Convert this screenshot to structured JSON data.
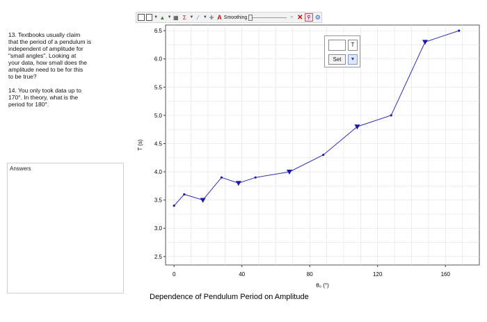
{
  "questions": {
    "q13": "13.  Textbooks usually claim\nthat the period of a pendulum is\nindependent of amplitude for\n\"small angles\".  Looking at\nyour data, how small does the\namplitude need to be for this\nto be true?",
    "q14": "14.  You only took data up to\n170°.  In theory, what is the\nperiod for 180°."
  },
  "answers": {
    "label": "Answers"
  },
  "toolbar": {
    "smoothing_label": "Smoothing"
  },
  "control": {
    "value": "",
    "t_label": "T",
    "set_label": "Set",
    "drop_symbol": "▼"
  },
  "colors": {
    "line": "#2b2bb8",
    "marker": "#1a1aa8",
    "grid": "#e0e0e0",
    "axis": "#333333"
  },
  "chart_data": {
    "type": "line",
    "title": "Dependence of Pendulum Period on Amplitude",
    "xlabel": "θ₀ (°)",
    "ylabel": "T (s)",
    "xlim": [
      -5,
      180
    ],
    "ylim": [
      2.35,
      6.6
    ],
    "xticks": [
      0,
      40,
      80,
      120,
      160
    ],
    "yticks": [
      2.5,
      3.0,
      3.5,
      4.0,
      4.5,
      5.0,
      5.5,
      6.0,
      6.5
    ],
    "grid": true,
    "x": [
      0,
      6,
      17,
      28,
      38,
      48,
      68,
      88,
      108,
      128,
      148,
      168
    ],
    "y": [
      3.4,
      3.6,
      3.5,
      3.9,
      3.8,
      3.9,
      4.0,
      4.3,
      4.8,
      5.0,
      6.3,
      6.5
    ],
    "marker_types": [
      "dot",
      "dot",
      "triangle",
      "dot",
      "triangle",
      "dot",
      "triangle",
      "dot",
      "triangle",
      "dot",
      "triangle",
      "dot"
    ]
  }
}
